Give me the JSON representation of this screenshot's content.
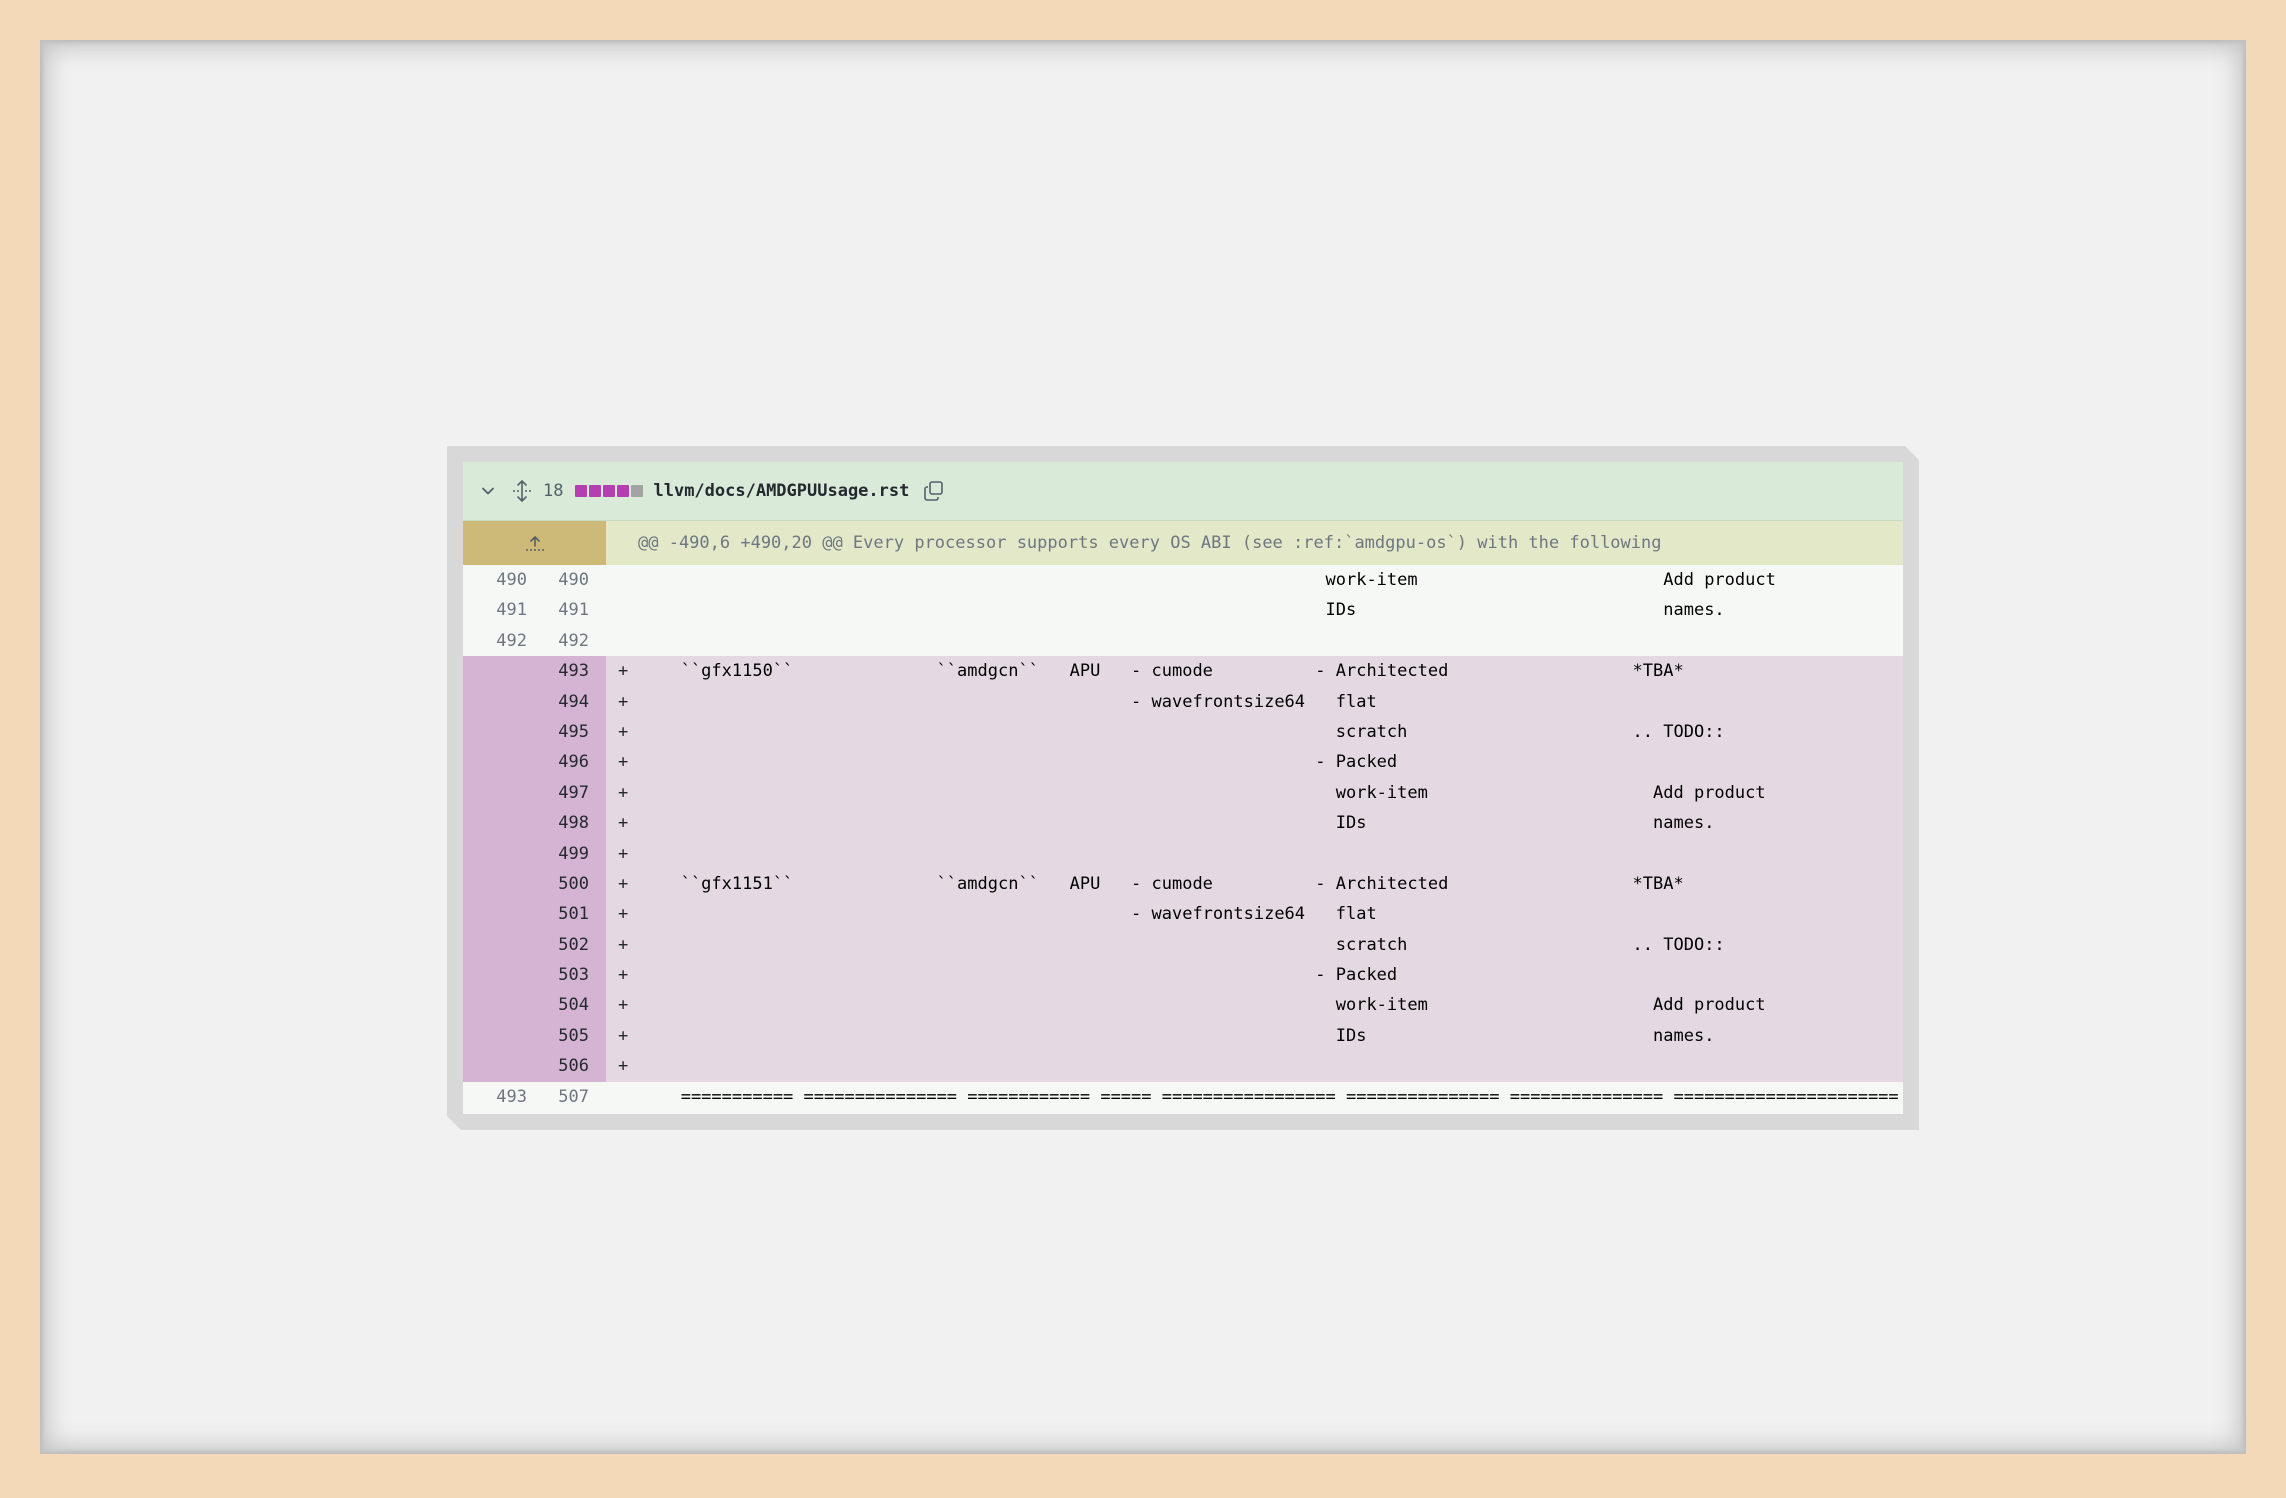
{
  "colors": {
    "header_bg": "#d9ead8",
    "hunk_bg": "#e3e8c8",
    "hunk_gutter": "#cdb978",
    "added_bg": "#e4d9e2",
    "added_gutter": "#d5b3d3",
    "diffstat_add": "#b53fb0",
    "diffstat_neutral": "#a3a3a3"
  },
  "file": {
    "collapse_icon": "chevron-down-icon",
    "expand_icon": "move-vertical-icon",
    "changes": "18",
    "diffstat": [
      "add",
      "add",
      "add",
      "add",
      "neutral"
    ],
    "path": "llvm/docs/AMDGPUUsage.rst",
    "copy_icon": "copy-icon"
  },
  "hunk": {
    "expand_icon": "expand-up-icon",
    "header": "@@ -490,6 +490,20 @@ Every processor supports every OS ABI (see :ref:`amdgpu-os`) with the following"
  },
  "lines": [
    {
      "type": "ctx",
      "old": "490",
      "new": "490",
      "sign": "",
      "code": "                                                                  work-item                        Add product"
    },
    {
      "type": "ctx",
      "old": "491",
      "new": "491",
      "sign": "",
      "code": "                                                                  IDs                              names."
    },
    {
      "type": "ctx",
      "old": "492",
      "new": "492",
      "sign": "",
      "code": ""
    },
    {
      "type": "add",
      "old": "",
      "new": "493",
      "sign": "+",
      "code": "   ``gfx1150``              ``amdgcn``   APU   - cumode          - Architected                  *TBA*"
    },
    {
      "type": "add",
      "old": "",
      "new": "494",
      "sign": "+",
      "code": "                                               - wavefrontsize64   flat"
    },
    {
      "type": "add",
      "old": "",
      "new": "495",
      "sign": "+",
      "code": "                                                                   scratch                      .. TODO::"
    },
    {
      "type": "add",
      "old": "",
      "new": "496",
      "sign": "+",
      "code": "                                                                 - Packed"
    },
    {
      "type": "add",
      "old": "",
      "new": "497",
      "sign": "+",
      "code": "                                                                   work-item                      Add product"
    },
    {
      "type": "add",
      "old": "",
      "new": "498",
      "sign": "+",
      "code": "                                                                   IDs                            names."
    },
    {
      "type": "add",
      "old": "",
      "new": "499",
      "sign": "+",
      "code": ""
    },
    {
      "type": "add",
      "old": "",
      "new": "500",
      "sign": "+",
      "code": "   ``gfx1151``              ``amdgcn``   APU   - cumode          - Architected                  *TBA*"
    },
    {
      "type": "add",
      "old": "",
      "new": "501",
      "sign": "+",
      "code": "                                               - wavefrontsize64   flat"
    },
    {
      "type": "add",
      "old": "",
      "new": "502",
      "sign": "+",
      "code": "                                                                   scratch                      .. TODO::"
    },
    {
      "type": "add",
      "old": "",
      "new": "503",
      "sign": "+",
      "code": "                                                                 - Packed"
    },
    {
      "type": "add",
      "old": "",
      "new": "504",
      "sign": "+",
      "code": "                                                                   work-item                      Add product"
    },
    {
      "type": "add",
      "old": "",
      "new": "505",
      "sign": "+",
      "code": "                                                                   IDs                            names."
    },
    {
      "type": "add",
      "old": "",
      "new": "506",
      "sign": "+",
      "code": ""
    },
    {
      "type": "tail",
      "old": "493",
      "new": "507",
      "sign": "",
      "code": "   =========== =============== ============ ===== ================= =============== =============== ======================"
    }
  ]
}
